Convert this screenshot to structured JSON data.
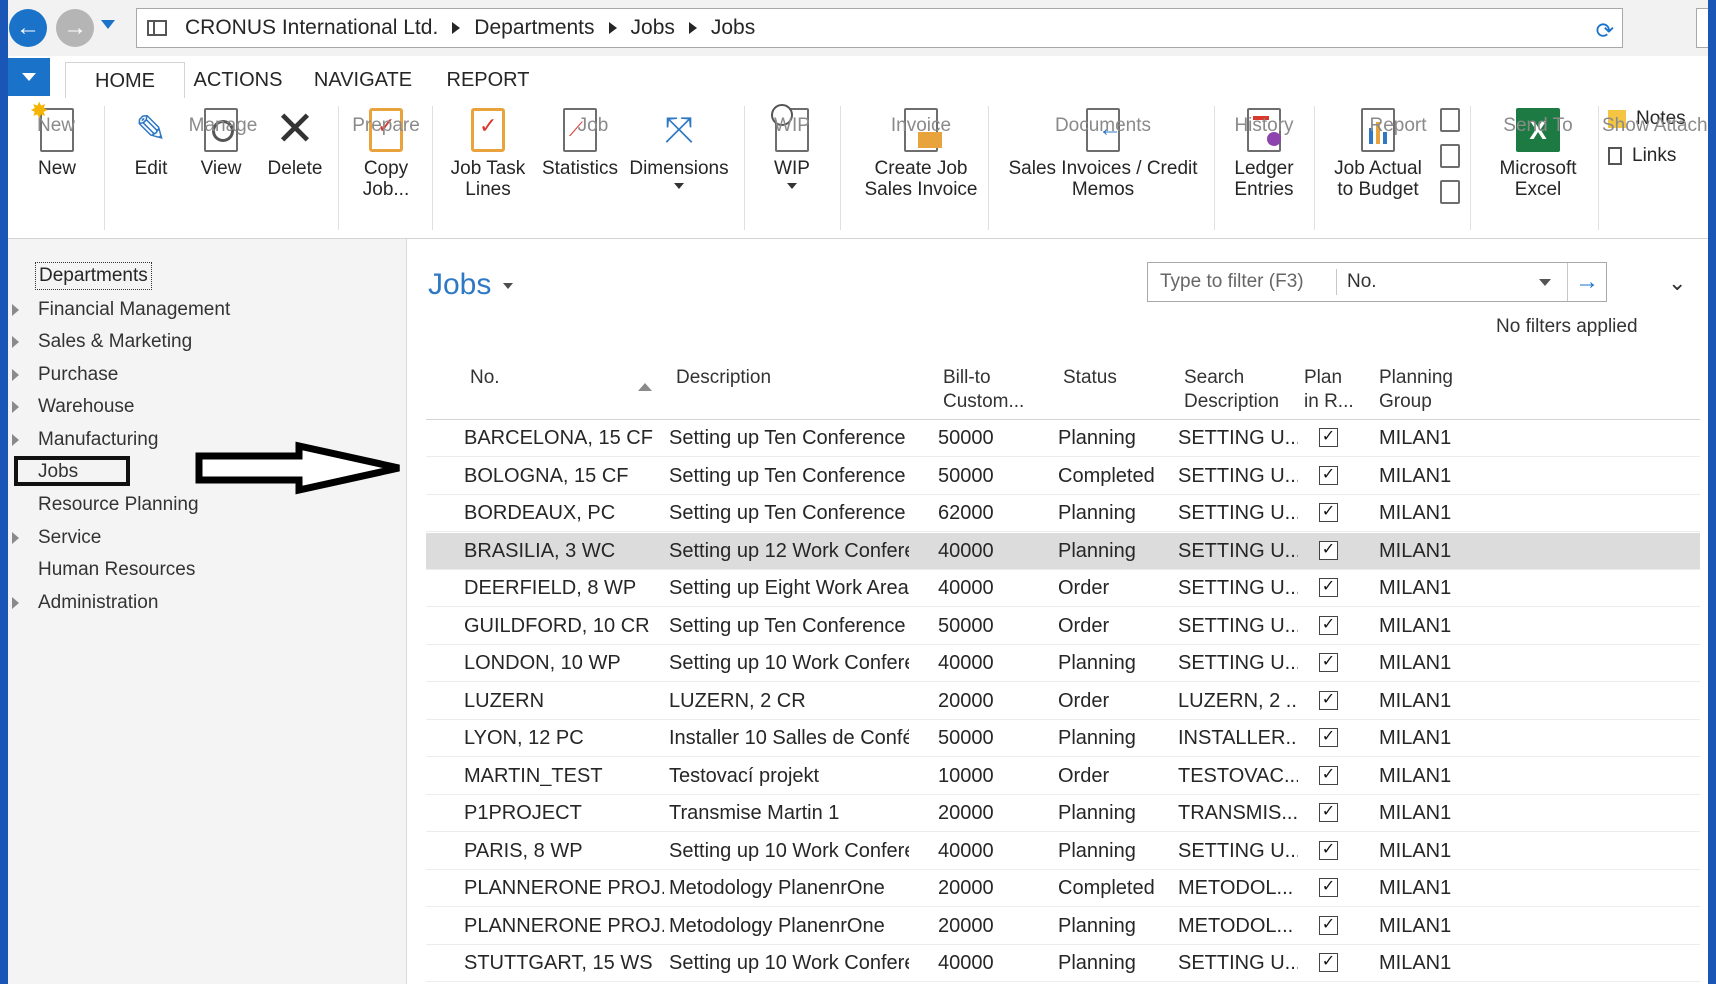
{
  "breadcrumb": [
    "CRONUS International Ltd.",
    "Departments",
    "Jobs",
    "Jobs"
  ],
  "ribbon": {
    "tabs": [
      "HOME",
      "ACTIONS",
      "NAVIGATE",
      "REPORT"
    ],
    "buttons": {
      "new": "New",
      "edit": "Edit",
      "view": "View",
      "delete": "Delete",
      "copy_job_1": "Copy",
      "copy_job_2": "Job...",
      "job_task_lines_1": "Job Task",
      "job_task_lines_2": "Lines",
      "statistics": "Statistics",
      "dimensions": "Dimensions",
      "wip": "WIP",
      "create_invoice_1": "Create Job",
      "create_invoice_2": "Sales Invoice",
      "sales_invoices_1": "Sales Invoices / Credit",
      "sales_invoices_2": "Memos",
      "ledger_1": "Ledger",
      "ledger_2": "Entries",
      "actual_budget_1": "Job Actual",
      "actual_budget_2": "to Budget",
      "excel_1": "Microsoft",
      "excel_2": "Excel",
      "notes": "Notes",
      "links": "Links"
    },
    "groups": {
      "new": "New",
      "manage": "Manage",
      "prepare": "Prepare",
      "job": "Job",
      "wip": "WIP",
      "invoice": "Invoice",
      "documents": "Documents",
      "history": "History",
      "report": "Report",
      "send_to": "Send To",
      "show_attached": "Show Attach"
    }
  },
  "sidebar": {
    "root": "Departments",
    "items": [
      "Financial Management",
      "Sales & Marketing",
      "Purchase",
      "Warehouse",
      "Manufacturing",
      "Jobs",
      "Resource Planning",
      "Service",
      "Human Resources",
      "Administration"
    ]
  },
  "page": {
    "title": "Jobs",
    "filter_placeholder": "Type to filter (F3)",
    "filter_field": "No.",
    "no_filters": "No filters applied"
  },
  "table": {
    "headers": {
      "no": "No.",
      "description": "Description",
      "bill_to_1": "Bill-to",
      "bill_to_2": "Custom...",
      "status": "Status",
      "search_1": "Search",
      "search_2": "Description",
      "plan_1": "Plan",
      "plan_2": "in R...",
      "group_1": "Planning",
      "group_2": "Group"
    },
    "rows": [
      {
        "no": "BARCELONA, 15 CF",
        "description": "Setting up Ten Conference ...",
        "bill_to": "50000",
        "status": "Planning",
        "search": "SETTING U...",
        "plan": true,
        "group": "MILAN1"
      },
      {
        "no": "BOLOGNA, 15 CF",
        "description": "Setting up Ten Conference ...",
        "bill_to": "50000",
        "status": "Completed",
        "search": "SETTING U...",
        "plan": true,
        "group": "MILAN1"
      },
      {
        "no": "BORDEAUX, PC",
        "description": "Setting up Ten Conference ...",
        "bill_to": "62000",
        "status": "Planning",
        "search": "SETTING U...",
        "plan": true,
        "group": "MILAN1"
      },
      {
        "no": "BRASILIA, 3 WC",
        "description": "Setting up 12 Work Confere...",
        "bill_to": "40000",
        "status": "Planning",
        "search": "SETTING U...",
        "plan": true,
        "group": "MILAN1"
      },
      {
        "no": "DEERFIELD, 8 WP",
        "description": "Setting up Eight Work Areas",
        "bill_to": "40000",
        "status": "Order",
        "search": "SETTING U...",
        "plan": true,
        "group": "MILAN1"
      },
      {
        "no": "GUILDFORD, 10 CR",
        "description": "Setting up Ten Conference ...",
        "bill_to": "50000",
        "status": "Order",
        "search": "SETTING U...",
        "plan": true,
        "group": "MILAN1"
      },
      {
        "no": "LONDON, 10 WP",
        "description": "Setting up 10 Work Confere...",
        "bill_to": "40000",
        "status": "Planning",
        "search": "SETTING U...",
        "plan": true,
        "group": "MILAN1"
      },
      {
        "no": "LUZERN",
        "description": "LUZERN, 2 CR",
        "bill_to": "20000",
        "status": "Order",
        "search": "LUZERN, 2 ...",
        "plan": true,
        "group": "MILAN1"
      },
      {
        "no": "LYON, 12 PC",
        "description": "Installer 10 Salles de Confér...",
        "bill_to": "50000",
        "status": "Planning",
        "search": "INSTALLER...",
        "plan": true,
        "group": "MILAN1"
      },
      {
        "no": "MARTIN_TEST",
        "description": "Testovací projekt",
        "bill_to": "10000",
        "status": "Order",
        "search": "TESTOVAC...",
        "plan": true,
        "group": "MILAN1"
      },
      {
        "no": "P1PROJECT",
        "description": "Transmise Martin 1",
        "bill_to": "20000",
        "status": "Planning",
        "search": "TRANSMIS...",
        "plan": true,
        "group": "MILAN1"
      },
      {
        "no": "PARIS, 8 WP",
        "description": "Setting up 10 Work Confere...",
        "bill_to": "40000",
        "status": "Planning",
        "search": "SETTING U...",
        "plan": true,
        "group": "MILAN1"
      },
      {
        "no": "PLANNERONE PROJ...",
        "description": "Metodology PlanenrOne",
        "bill_to": "20000",
        "status": "Completed",
        "search": "METODOL...",
        "plan": true,
        "group": "MILAN1"
      },
      {
        "no": "PLANNERONE PROJ...",
        "description": "Metodology PlanenrOne",
        "bill_to": "20000",
        "status": "Planning",
        "search": "METODOL...",
        "plan": true,
        "group": "MILAN1"
      },
      {
        "no": "STUTTGART, 15 WS",
        "description": "Setting up 10 Work Confere...",
        "bill_to": "40000",
        "status": "Planning",
        "search": "SETTING U...",
        "plan": true,
        "group": "MILAN1"
      }
    ],
    "selected_row": "BRASILIA, 3 WC"
  },
  "colors": {
    "accent": "#1a73c9",
    "title": "#2f78c4",
    "frame": "#1a56b5",
    "selected_row": "#dcdcdc"
  }
}
